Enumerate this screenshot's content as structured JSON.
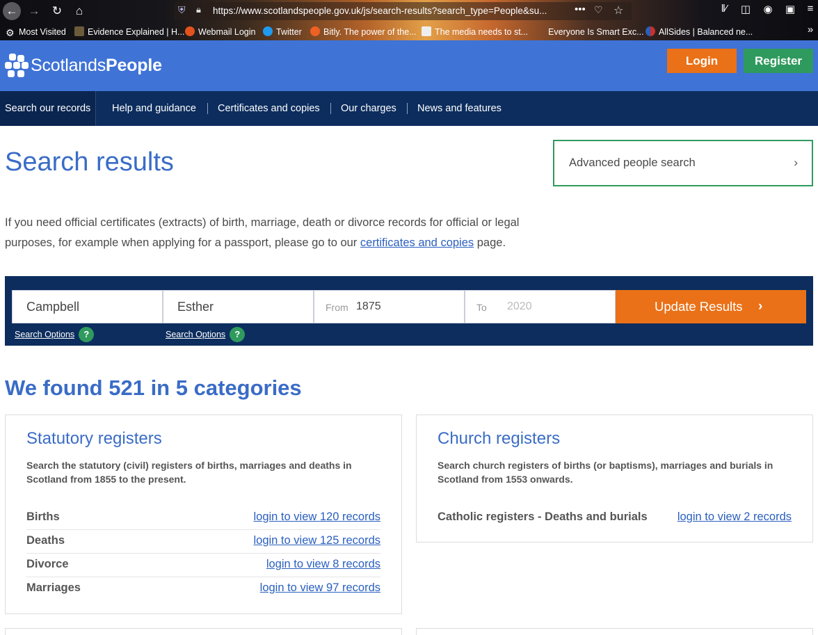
{
  "browser": {
    "url": "https://www.scotlandspeople.gov.uk/js/search-results?search_type=People&su...",
    "bookmarks": [
      {
        "label": "Most Visited",
        "icon": "gear-icon"
      },
      {
        "label": "Evidence Explained | H...",
        "icon": "book-icon"
      },
      {
        "label": "Webmail Login",
        "icon": "cpanel-icon"
      },
      {
        "label": "Twitter",
        "icon": "twitter-icon"
      },
      {
        "label": "Bitly. The power of the...",
        "icon": "bitly-icon"
      },
      {
        "label": "The media needs to st...",
        "icon": "newspaper-icon"
      },
      {
        "label": "Everyone Is Smart Exc...",
        "icon": "blank-page-icon"
      },
      {
        "label": "AllSides | Balanced ne...",
        "icon": "allsides-icon"
      }
    ]
  },
  "header": {
    "logo_text_light": "Scotlands",
    "logo_text_bold": "People",
    "login_label": "Login",
    "register_label": "Register",
    "login_color": "#ea7117",
    "register_color": "#2f9a5d",
    "header_color": "#3f73d6",
    "nav_color": "#0c2d5e"
  },
  "nav": {
    "items": [
      "Search our records",
      "Help and guidance",
      "Certificates and copies",
      "Our charges",
      "News and features"
    ]
  },
  "main": {
    "title": "Search results",
    "advanced_search_label": "Advanced people search",
    "intro_before": "If you need official certificates (extracts) of birth, marriage, death or divorce records for official or legal purposes, for example when applying for a passport, please go to our ",
    "intro_link": "certificates and copies",
    "intro_after": " page."
  },
  "search": {
    "surname": "Campbell",
    "forename": "Esther",
    "from_label": "From",
    "from_value": "1875",
    "to_label": "To",
    "to_placeholder": "2020",
    "update_label": "Update Results",
    "options_label": "Search Options",
    "help_glyph": "?"
  },
  "results": {
    "summary": "We found 521 in 5 categories",
    "cards": [
      {
        "title": "Statutory registers",
        "description": "Search the statutory (civil) registers of births, marriages and deaths in Scotland from 1855 to the present.",
        "rows": [
          {
            "name": "Births",
            "link": "login to view 120 records"
          },
          {
            "name": "Deaths",
            "link": "login to view 125 records"
          },
          {
            "name": "Divorce",
            "link": "login to view 8 records"
          },
          {
            "name": "Marriages",
            "link": "login to view 97 records"
          }
        ]
      },
      {
        "title": "Church registers",
        "description": "Search church registers of births (or baptisms), marriages and burials in Scotland from 1553 onwards.",
        "rows": [
          {
            "name": "Catholic registers - Deaths and burials",
            "link": "login to view 2 records"
          }
        ]
      }
    ]
  }
}
